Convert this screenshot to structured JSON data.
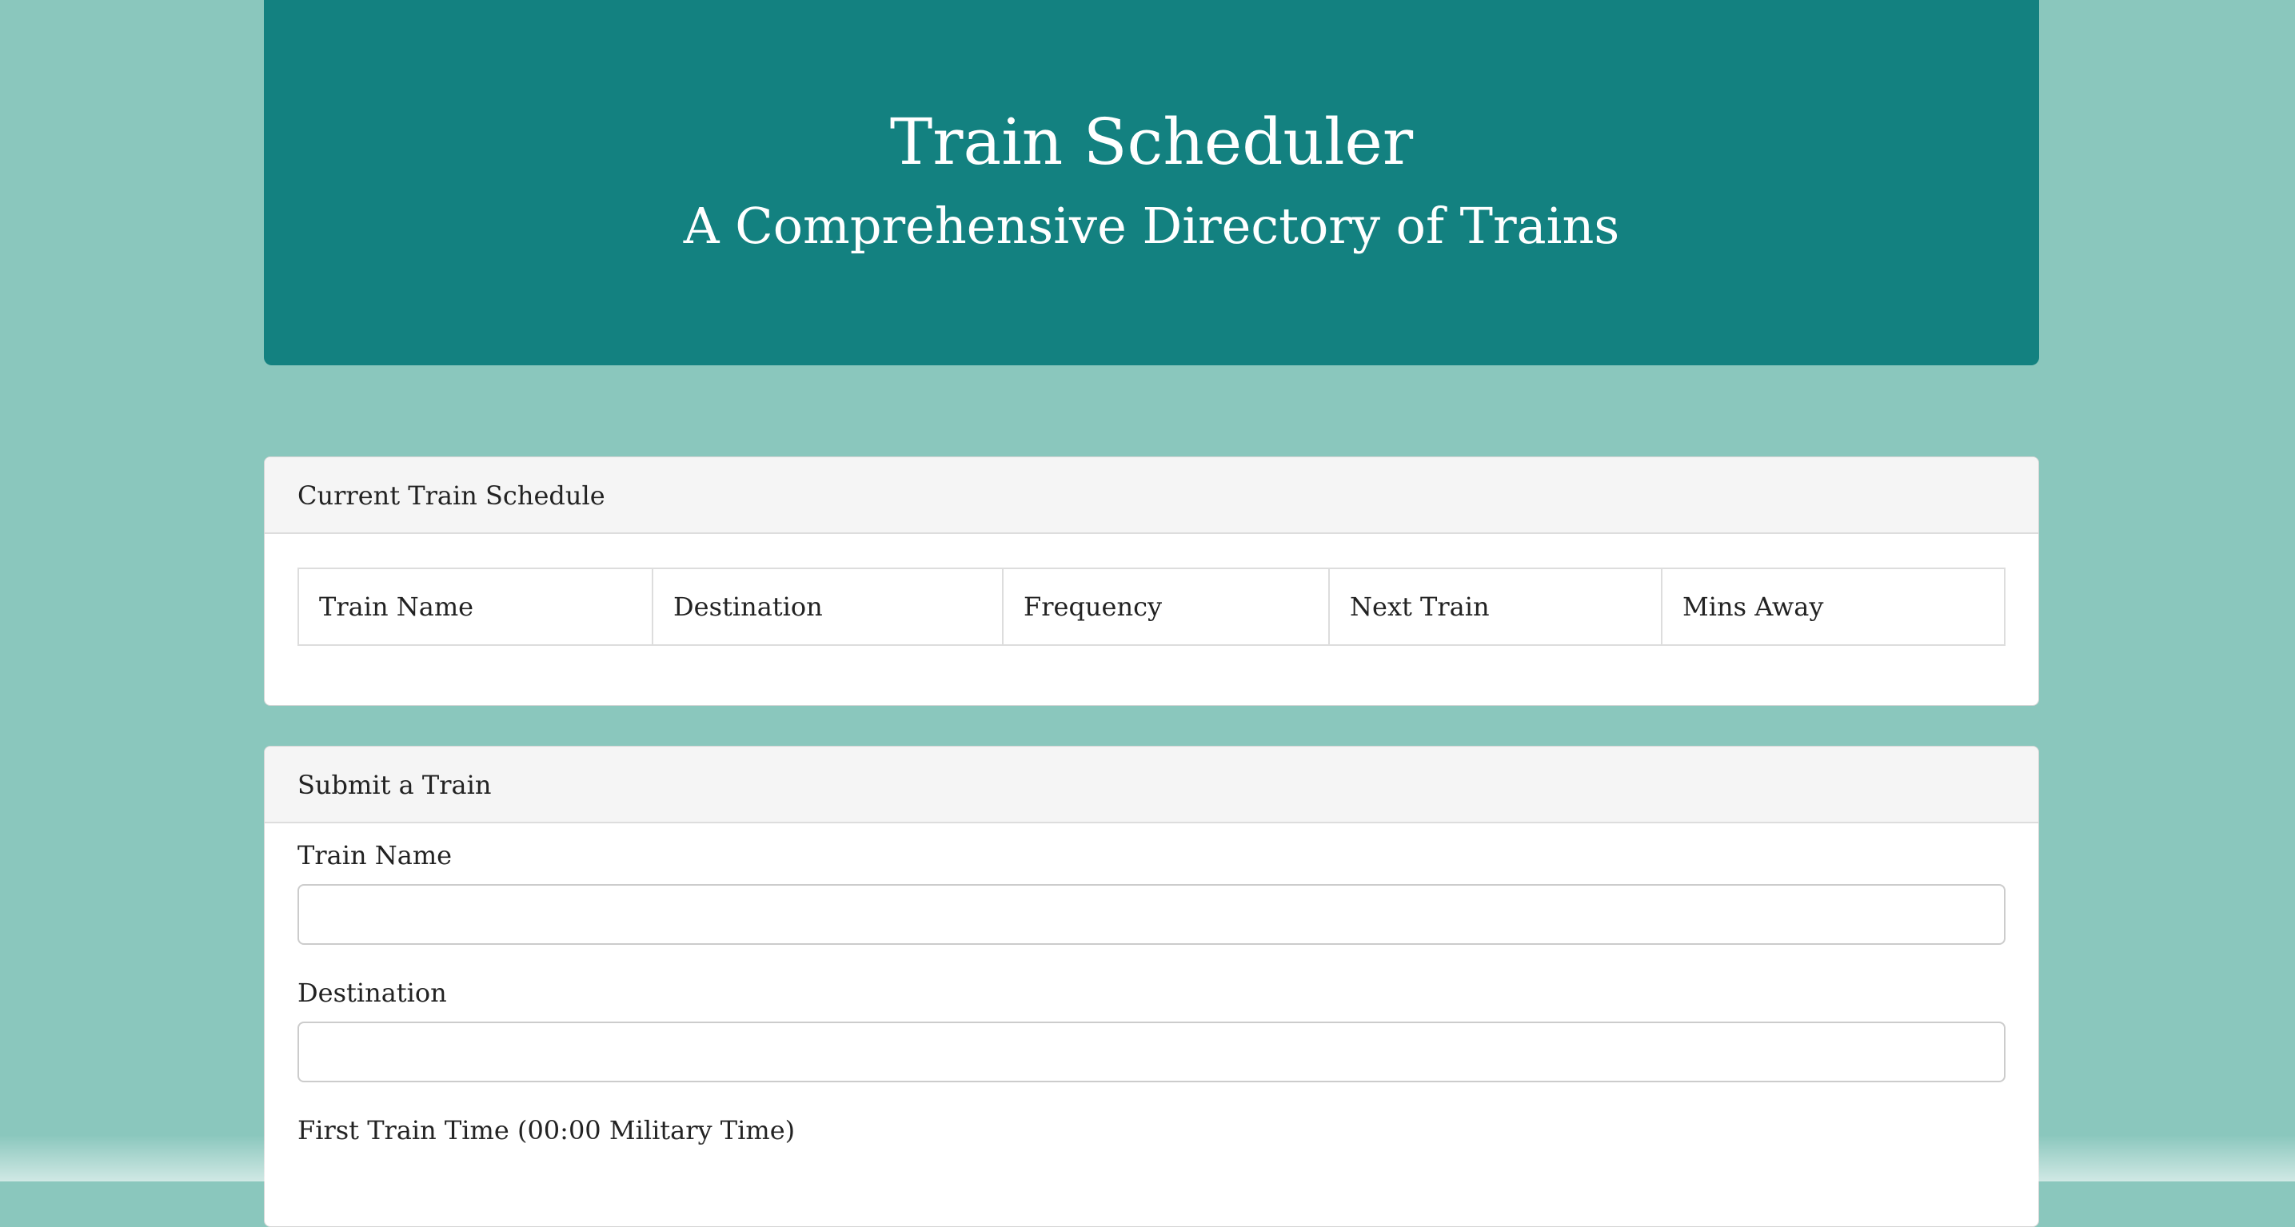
{
  "header": {
    "title": "Train Scheduler",
    "subtitle": "A Comprehensive Directory of Trains",
    "background_color": "#138180"
  },
  "schedule_panel": {
    "heading": "Current Train Schedule",
    "columns": [
      "Train Name",
      "Destination",
      "Frequency",
      "Next Train",
      "Mins Away"
    ]
  },
  "submit_panel": {
    "heading": "Submit a Train",
    "fields": [
      {
        "label": "Train Name",
        "value": "",
        "placeholder": ""
      },
      {
        "label": "Destination",
        "value": "",
        "placeholder": ""
      },
      {
        "label": "First Train Time (00:00 Military Time)",
        "value": "",
        "placeholder": ""
      }
    ]
  },
  "colors": {
    "page_background": "#8ac7bd",
    "accent": "#138180"
  }
}
